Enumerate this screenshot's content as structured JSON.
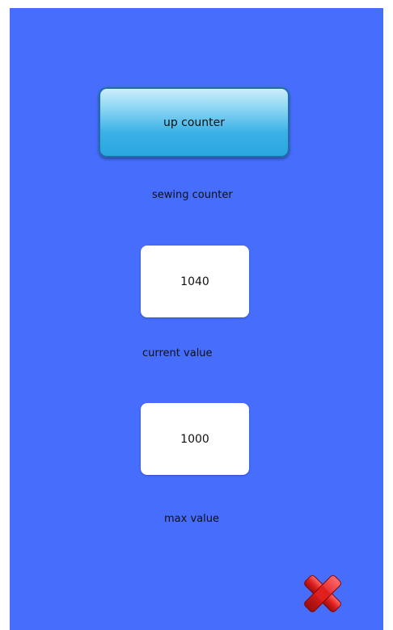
{
  "mode_button": {
    "label": "up counter"
  },
  "counter": {
    "title": "sewing counter"
  },
  "current": {
    "value": "1040",
    "label": "current value"
  },
  "max": {
    "value": "1000",
    "label": "max value"
  },
  "close_icon": "close-x-red",
  "colors": {
    "background": "#466dfb",
    "button": "#3bb1e6",
    "close": "#d81b1b"
  }
}
